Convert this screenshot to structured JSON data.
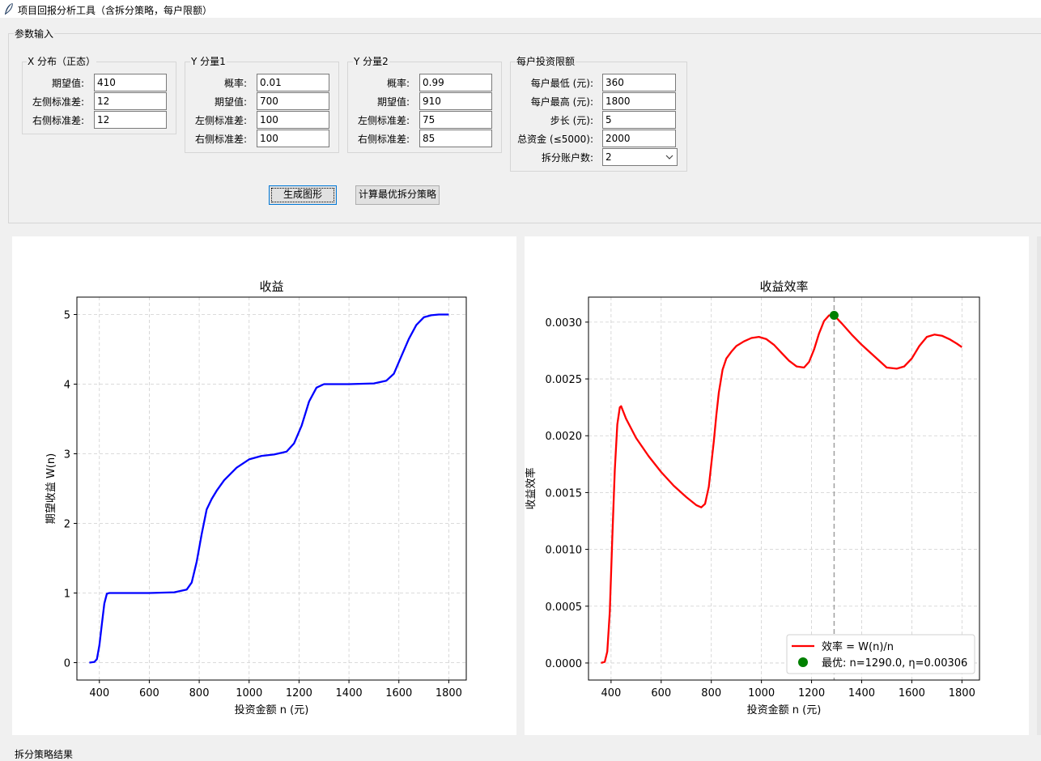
{
  "window": {
    "title": "项目回报分析工具（含拆分策略，每户限额）"
  },
  "params": {
    "title": "参数输入",
    "x_group": {
      "title": "X 分布（正态）",
      "fields": [
        {
          "label": "期望值:",
          "value": "410"
        },
        {
          "label": "左侧标准差:",
          "value": "12"
        },
        {
          "label": "右侧标准差:",
          "value": "12"
        }
      ]
    },
    "y1_group": {
      "title": "Y 分量1",
      "fields": [
        {
          "label": "概率:",
          "value": "0.01"
        },
        {
          "label": "期望值:",
          "value": "700"
        },
        {
          "label": "左侧标准差:",
          "value": "100"
        },
        {
          "label": "右侧标准差:",
          "value": "100"
        }
      ]
    },
    "y2_group": {
      "title": "Y 分量2",
      "fields": [
        {
          "label": "概率:",
          "value": "0.99"
        },
        {
          "label": "期望值:",
          "value": "910"
        },
        {
          "label": "左侧标准差:",
          "value": "75"
        },
        {
          "label": "右侧标准差:",
          "value": "85"
        }
      ]
    },
    "limit_group": {
      "title": "每户投资限额",
      "fields": [
        {
          "label": "每户最低 (元):",
          "value": "360"
        },
        {
          "label": "每户最高 (元):",
          "value": "1800"
        },
        {
          "label": "步长 (元):",
          "value": "5"
        },
        {
          "label": "总资金 (≤5000):",
          "value": "2000"
        },
        {
          "label": "拆分账户数:",
          "value": "2"
        }
      ]
    },
    "buttons": {
      "generate": "生成图形",
      "optimize": "计算最优拆分策略"
    }
  },
  "bottom_label": "拆分策略结果",
  "colors": {
    "line1": "#0000ff",
    "line2": "#ff0000",
    "marker": "#008000",
    "vline": "#a0a0a0"
  },
  "chart_data": [
    {
      "type": "line",
      "title": "收益",
      "xlabel": "投资金额 n (元)",
      "ylabel": "期望收益 W(n)",
      "xlim": [
        310,
        1870
      ],
      "ylim": [
        -0.25,
        5.25
      ],
      "xticks": [
        400,
        600,
        800,
        1000,
        1200,
        1400,
        1600,
        1800
      ],
      "yticks": [
        0,
        1,
        2,
        3,
        4,
        5
      ],
      "grid": true,
      "series": [
        {
          "x": [
            360,
            380,
            390,
            400,
            410,
            420,
            430,
            440,
            500,
            600,
            700,
            750,
            770,
            790,
            810,
            830,
            850,
            870,
            900,
            950,
            1000,
            1050,
            1100,
            1150,
            1180,
            1210,
            1240,
            1270,
            1300,
            1330,
            1400,
            1500,
            1550,
            1580,
            1610,
            1640,
            1670,
            1700,
            1730,
            1760,
            1800
          ],
          "y": [
            0,
            0.01,
            0.05,
            0.25,
            0.55,
            0.85,
            0.99,
            1.0,
            1.0,
            1.0,
            1.01,
            1.05,
            1.15,
            1.45,
            1.85,
            2.2,
            2.35,
            2.47,
            2.62,
            2.8,
            2.92,
            2.97,
            2.99,
            3.03,
            3.15,
            3.4,
            3.75,
            3.95,
            4.0,
            4.0,
            4.0,
            4.01,
            4.05,
            4.15,
            4.4,
            4.65,
            4.85,
            4.96,
            4.99,
            5.0,
            5.0
          ]
        }
      ]
    },
    {
      "type": "line",
      "title": "收益效率",
      "xlabel": "投资金额 n (元)",
      "ylabel": "收益效率",
      "xlim": [
        310,
        1870
      ],
      "ylim": [
        -0.00015,
        0.00322
      ],
      "xticks": [
        400,
        600,
        800,
        1000,
        1200,
        1400,
        1600,
        1800
      ],
      "yticks": [
        0,
        0.0005,
        0.001,
        0.0015,
        0.002,
        0.0025,
        0.003
      ],
      "ytick_labels": [
        "0.0000",
        "0.0005",
        "0.0010",
        "0.0015",
        "0.0020",
        "0.0025",
        "0.0030"
      ],
      "grid": true,
      "legend": "lower-right",
      "series": [
        {
          "name": "效率 = W(n)/n",
          "x": [
            360,
            375,
            385,
            395,
            405,
            415,
            425,
            435,
            440,
            460,
            500,
            550,
            600,
            650,
            700,
            740,
            760,
            775,
            790,
            800,
            810,
            820,
            830,
            845,
            860,
            880,
            900,
            930,
            960,
            990,
            1020,
            1050,
            1080,
            1110,
            1140,
            1170,
            1190,
            1210,
            1230,
            1250,
            1270,
            1290,
            1320,
            1360,
            1400,
            1450,
            1500,
            1540,
            1570,
            1600,
            1630,
            1660,
            1690,
            1720,
            1750,
            1780,
            1800
          ],
          "y": [
            0,
            1e-05,
            0.0001,
            0.00045,
            0.0011,
            0.0017,
            0.0021,
            0.00225,
            0.00226,
            0.00215,
            0.00198,
            0.00182,
            0.00168,
            0.00156,
            0.00146,
            0.00139,
            0.00137,
            0.0014,
            0.00155,
            0.00175,
            0.00195,
            0.00218,
            0.00238,
            0.00258,
            0.00268,
            0.00274,
            0.00279,
            0.00283,
            0.00286,
            0.00287,
            0.00285,
            0.0028,
            0.00273,
            0.00266,
            0.00261,
            0.0026,
            0.00265,
            0.00276,
            0.0029,
            0.00301,
            0.00306,
            0.00306,
            0.00299,
            0.00289,
            0.0028,
            0.0027,
            0.0026,
            0.00259,
            0.00261,
            0.00268,
            0.00279,
            0.00287,
            0.00289,
            0.00288,
            0.00285,
            0.00281,
            0.00278
          ]
        }
      ],
      "optimum": {
        "label": "最优: n=1290.0, η=0.00306",
        "x": 1290.0,
        "y": 0.00306
      }
    }
  ]
}
